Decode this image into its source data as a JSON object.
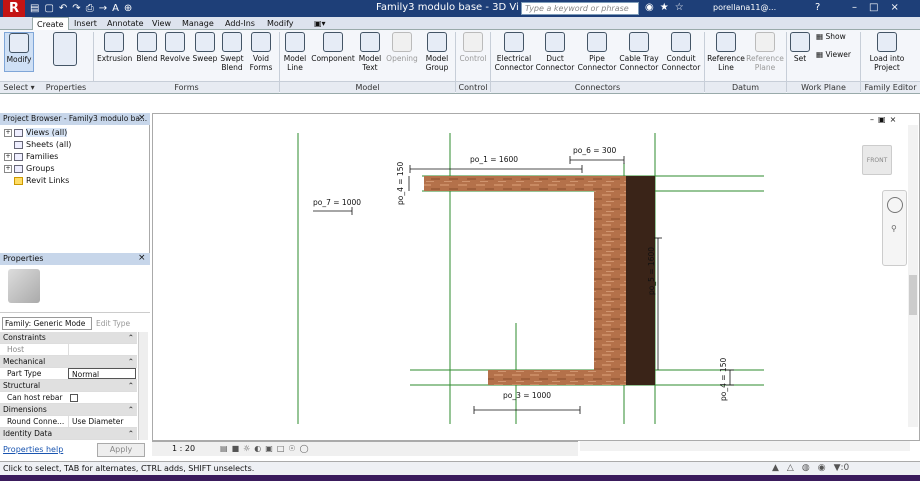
{
  "app": {
    "logo": "R",
    "title": "Family3 modulo base - 3D Vi...",
    "search_placeholder": "Type a keyword or phrase",
    "user": "porellana11@...",
    "help": "?"
  },
  "qat": [
    "▤",
    "▢",
    "↶",
    "↷",
    "⎙",
    "→",
    "A",
    "⊕"
  ],
  "tabs": [
    "Create",
    "Insert",
    "Annotate",
    "View",
    "Manage",
    "Add-Ins",
    "Modify"
  ],
  "active_tab": "Create",
  "ribbon": {
    "buttons": {
      "modify": "Modify",
      "extrusion": "Extrusion",
      "blend": "Blend",
      "revolve": "Revolve",
      "sweep": "Sweep",
      "swept_blend": "Swept Blend",
      "void_forms": "Void Forms",
      "model_line": "Model Line",
      "component": "Component",
      "model_text": "Model Text",
      "opening": "Opening",
      "model_group": "Model Group",
      "control": "Control",
      "electrical_connector": "Electrical Connector",
      "duct_connector": "Duct Connector",
      "pipe_connector": "Pipe Connector",
      "cable_tray_connector": "Cable Tray Connector",
      "conduit_connector": "Conduit Connector",
      "reference_line": "Reference Line",
      "reference_plane": "Reference Plane",
      "set": "Set",
      "show": "Show",
      "viewer": "Viewer",
      "load_into_project": "Load into Project"
    },
    "groups": {
      "select": "Select ▾",
      "properties": "Properties",
      "forms": "Forms",
      "model": "Model",
      "control": "Control",
      "connectors": "Connectors",
      "datum": "Datum",
      "work_plane": "Work Plane",
      "family_editor": "Family Editor"
    }
  },
  "project_browser": {
    "title": "Project Browser - Family3 modulo ba...",
    "items": [
      "Views (all)",
      "Sheets (all)",
      "Families",
      "Groups",
      "Revit Links"
    ]
  },
  "properties": {
    "title": "Properties",
    "family": "Family: Generic Mode",
    "edit_type": "Edit Type",
    "rows": [
      {
        "cat": "Constraints"
      },
      {
        "key": "Host",
        "value": ""
      },
      {
        "cat": "Mechanical"
      },
      {
        "key": "Part Type",
        "value": "Normal"
      },
      {
        "cat": "Structural"
      },
      {
        "key": "Can host rebar",
        "value": ""
      },
      {
        "cat": "Dimensions"
      },
      {
        "key": "Round Conne...",
        "value": "Use Diameter"
      },
      {
        "cat": "Identity Data"
      }
    ],
    "help_link": "Properties help",
    "apply": "Apply"
  },
  "view": {
    "scale": "1 : 20",
    "viewcube": "FRONT",
    "dimensions": {
      "po_1": "po_1 = 1600",
      "po_6": "po_6 = 300",
      "po_4a": "po_4 = 150",
      "po_7": "po_7 = 1000",
      "po_5": "po_5 = 1600",
      "po_3": "po_3 = 1000",
      "po_4b": "po_4 = 150"
    }
  },
  "status": {
    "text": "Click to select, TAB for alternates, CTRL adds, SHIFT unselects.",
    "filter": ":0"
  },
  "colors": {
    "wood": "#b4714a",
    "dark_wood": "#3a2418",
    "ref_plane": "#2e8b2e"
  }
}
